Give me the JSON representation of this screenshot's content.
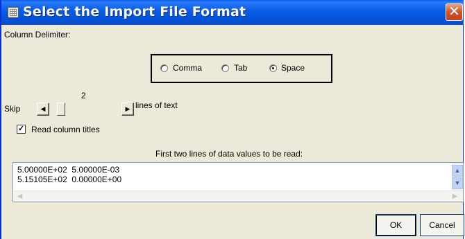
{
  "window": {
    "title": "Select the Import File Format",
    "close_glyph": "✕",
    "icon": "table-icon"
  },
  "delimiter": {
    "label": "Column Delimiter:",
    "options": [
      {
        "label": "Comma",
        "selected": false
      },
      {
        "label": "Tab",
        "selected": false
      },
      {
        "label": "Space",
        "selected": true
      }
    ]
  },
  "skip": {
    "label": "Skip",
    "value": "2",
    "suffix": "lines of text"
  },
  "read_titles": {
    "label": "Read column titles",
    "checked": true,
    "mark": "✓"
  },
  "preview": {
    "label": "First two lines of data values to be read:",
    "lines": [
      "5.00000E+02  5.00000E-03",
      "5.15105E+02  0.00000E+00"
    ]
  },
  "buttons": {
    "ok": "OK",
    "cancel": "Cancel"
  }
}
